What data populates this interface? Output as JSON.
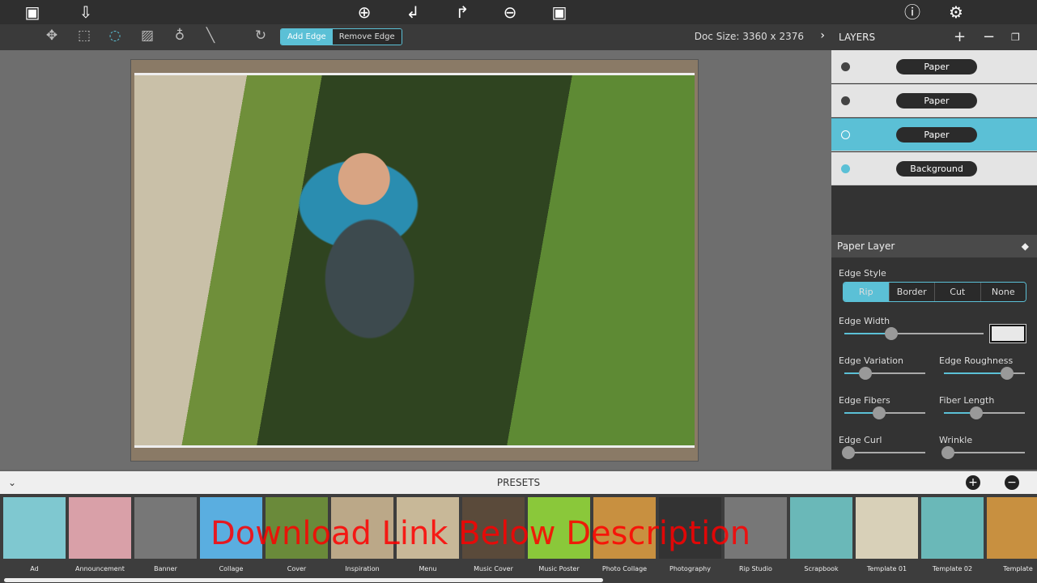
{
  "topbar": {
    "icons": [
      "open-image-icon",
      "save-icon",
      "zoom-in-icon",
      "undo-icon",
      "redo-icon",
      "zoom-out-icon",
      "fit-icon",
      "info-icon",
      "settings-icon"
    ]
  },
  "toolbar": {
    "add_edge": "Add Edge",
    "remove_edge": "Remove Edge",
    "doc_size": "Doc Size: 3360 x 2376",
    "accent": "#5bc0d6"
  },
  "layers": {
    "title": "LAYERS",
    "items": [
      {
        "label": "Paper",
        "selected": false
      },
      {
        "label": "Paper",
        "selected": false
      },
      {
        "label": "Paper",
        "selected": true
      },
      {
        "label": "Background",
        "selected": false
      }
    ]
  },
  "paper_layer": {
    "title": "Paper Layer",
    "edge_style_label": "Edge Style",
    "edge_styles": [
      "Rip",
      "Border",
      "Cut",
      "None"
    ],
    "selected_style": "Rip",
    "sliders": {
      "edge_width": {
        "label": "Edge Width",
        "value": 0.34
      },
      "edge_variation": {
        "label": "Edge Variation",
        "value": 0.26
      },
      "edge_roughness": {
        "label": "Edge Roughness",
        "value": 0.78
      },
      "edge_fibers": {
        "label": "Edge Fibers",
        "value": 0.43
      },
      "fiber_length": {
        "label": "Fiber Length",
        "value": 0.4
      },
      "edge_curl": {
        "label": "Edge Curl",
        "value": 0.05
      },
      "wrinkle": {
        "label": "Wrinkle",
        "value": 0.05
      }
    }
  },
  "presets": {
    "title": "PRESETS",
    "items": [
      "Ad",
      "Announcement",
      "Banner",
      "Collage",
      "Cover",
      "Inspiration",
      "Menu",
      "Music Cover",
      "Music Poster",
      "Photo Collage",
      "Photography",
      "Rip Studio",
      "Scrapbook",
      "Template 01",
      "Template 02",
      "Template"
    ]
  },
  "watermark": "Download Link Below Description"
}
